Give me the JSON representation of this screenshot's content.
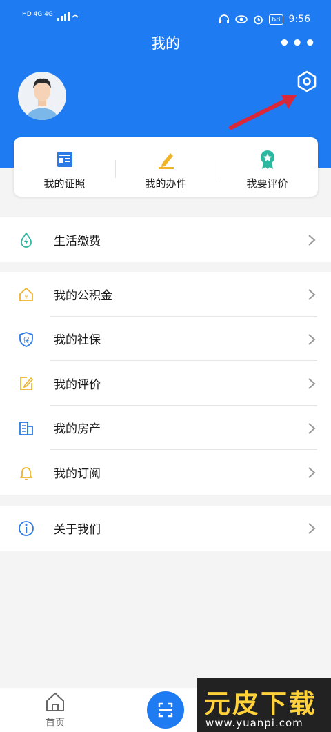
{
  "status_bar": {
    "network_left": "HD 4G 4G",
    "battery": "68",
    "time": "9:56"
  },
  "header": {
    "title": "我的",
    "more_label": "•••"
  },
  "profile": {
    "avatar": "avatar"
  },
  "settings": {
    "icon": "settings-hex-icon"
  },
  "quick_actions": [
    {
      "label": "我的证照",
      "icon": "id-card-icon",
      "color": "#2c7be5"
    },
    {
      "label": "我的办件",
      "icon": "pencil-icon",
      "color": "#f0b429"
    },
    {
      "label": "我要评价",
      "icon": "award-icon",
      "color": "#2bb7a0"
    }
  ],
  "menu_groups": [
    [
      {
        "label": "生活缴费",
        "icon": "water-drop-icon"
      }
    ],
    [
      {
        "label": "我的公积金",
        "icon": "house-yuan-icon"
      },
      {
        "label": "我的社保",
        "icon": "shield-bao-icon"
      },
      {
        "label": "我的评价",
        "icon": "edit-square-icon"
      },
      {
        "label": "我的房产",
        "icon": "building-icon"
      },
      {
        "label": "我的订阅",
        "icon": "bell-icon"
      }
    ],
    [
      {
        "label": "关于我们",
        "icon": "info-icon"
      }
    ]
  ],
  "tab_bar": {
    "home_label": "首页"
  },
  "watermark": {
    "brand": "元皮下载",
    "url": "www.yuanpi.com"
  },
  "colors": {
    "primary": "#1f7bf2",
    "accent_yellow": "#f0b429",
    "accent_teal": "#2bb7a0",
    "arrow_red": "#d9283a"
  }
}
